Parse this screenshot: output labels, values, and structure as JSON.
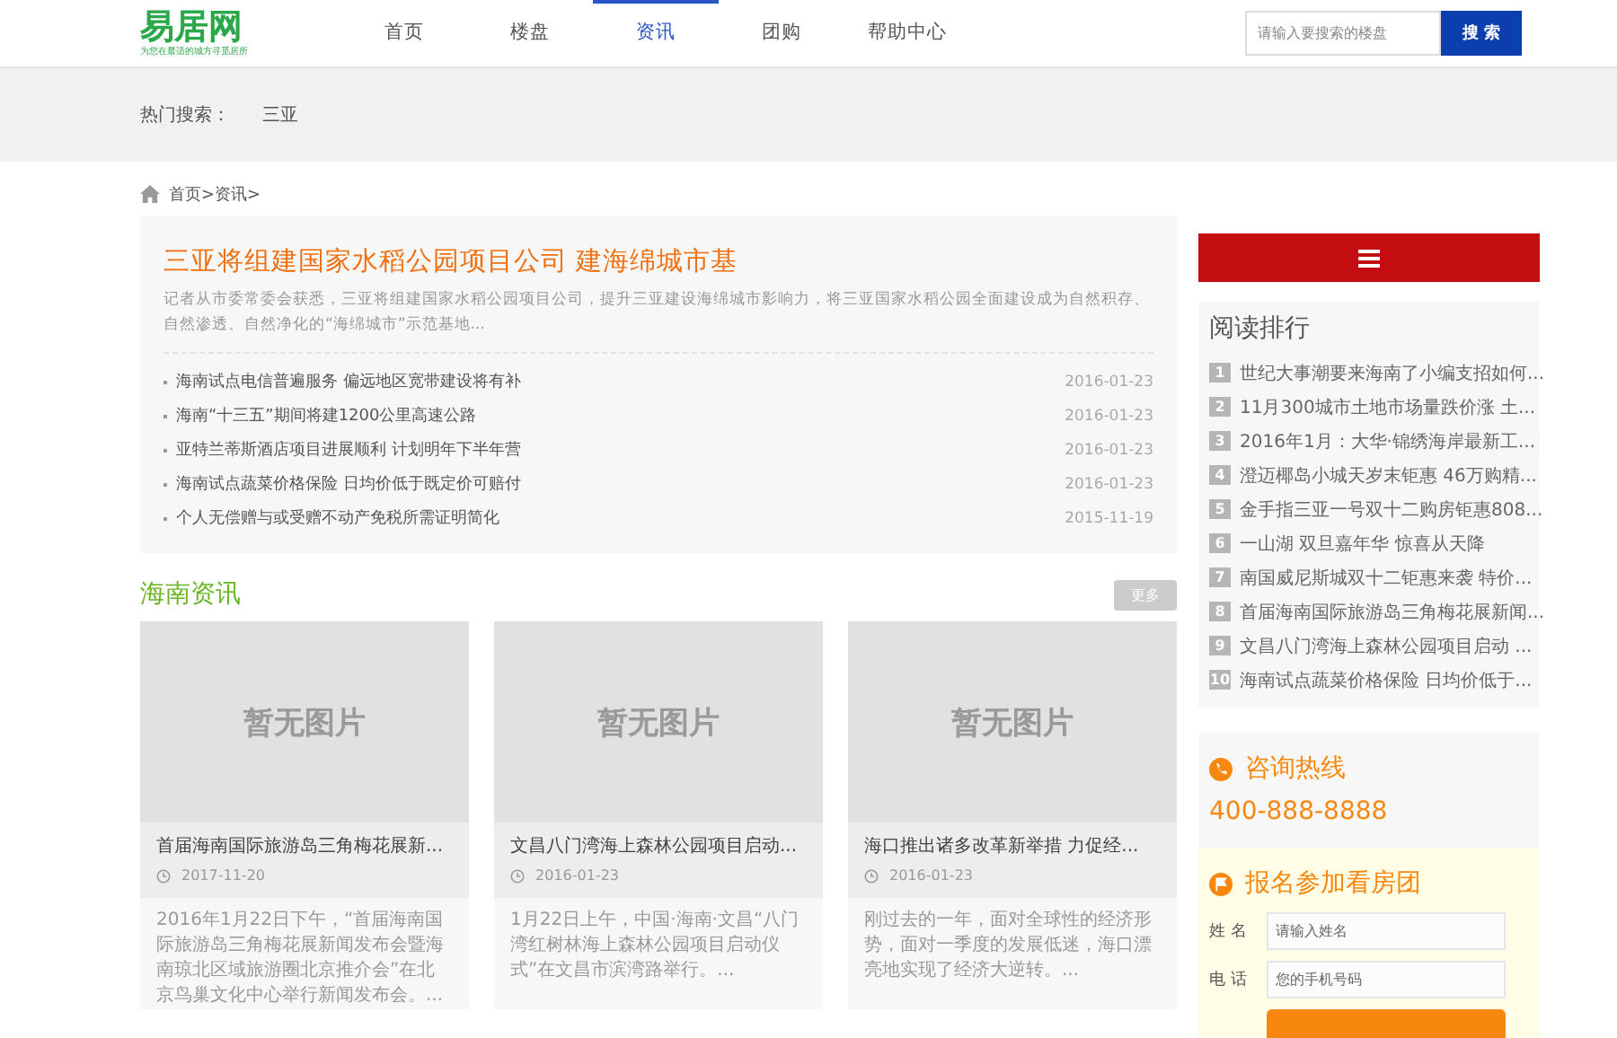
{
  "logo": {
    "name": "易居网",
    "tagline": "为您在最适的城方寻觅居所"
  },
  "nav": [
    {
      "label": "首页",
      "selected": false
    },
    {
      "label": "楼盘",
      "selected": false
    },
    {
      "label": "资讯",
      "selected": true
    },
    {
      "label": "团购",
      "selected": false
    },
    {
      "label": "帮助中心",
      "selected": false
    }
  ],
  "search": {
    "placeholder": "请输入要搜索的楼盘",
    "button": "搜 索"
  },
  "hot_search": {
    "label": "热门搜索：",
    "items": [
      "三亚"
    ]
  },
  "breadcrumb": "首页>资讯>",
  "featured": {
    "title": "三亚将组建国家水稻公园项目公司 建海绵城市基",
    "summary": "记者从市委常委会获悉，三亚将组建国家水稻公园项目公司，提升三亚建设海绵城市影响力，将三亚国家水稻公园全面建设成为自然积存、自然渗透、自然净化的“海绵城市”示范基地...",
    "list": [
      {
        "title": "海南试点电信普遍服务 偏远地区宽带建设将有补",
        "date": "2016-01-23"
      },
      {
        "title": "海南“十三五”期间将建1200公里高速公路",
        "date": "2016-01-23"
      },
      {
        "title": "亚特兰蒂斯酒店项目进展顺利 计划明年下半年营",
        "date": "2016-01-23"
      },
      {
        "title": "海南试点蔬菜价格保险 日均价低于既定价可赔付",
        "date": "2016-01-23"
      },
      {
        "title": "个人无偿赠与或受赠不动产免税所需证明简化",
        "date": "2015-11-19"
      }
    ]
  },
  "section": {
    "title": "海南资讯",
    "more": "更多"
  },
  "cards": [
    {
      "placeholder": "暂无图片",
      "title": "首届海南国际旅游岛三角梅花展新...",
      "date": "2017-11-20",
      "excerpt": "2016年1月22日下午，“首届海南国际旅游岛三角梅花展新闻发布会暨海南琼北区域旅游圈北京推介会”在北京鸟巢文化中心举行新闻发布会。..."
    },
    {
      "placeholder": "暂无图片",
      "title": "文昌八门湾海上森林公园项目启动...",
      "date": "2016-01-23",
      "excerpt": "1月22日上午，中国·海南·文昌“八门湾红树林海上森林公园项目启动仪式”在文昌市滨湾路举行。..."
    },
    {
      "placeholder": "暂无图片",
      "title": "海口推出诸多改革新举措 力促经...",
      "date": "2016-01-23",
      "excerpt": "刚过去的一年，面对全球性的经济形势，面对一季度的发展低迷，海口漂亮地实现了经济大逆转。..."
    }
  ],
  "ranking": {
    "title": "阅读排行",
    "items": [
      {
        "rank": "1",
        "title": "世纪大事潮要来海南了小编支招如何..."
      },
      {
        "rank": "2",
        "title": "11月300城市土地市场量跌价涨 土..."
      },
      {
        "rank": "3",
        "title": "2016年1月：大华·锦绣海岸最新工..."
      },
      {
        "rank": "4",
        "title": "澄迈椰岛小城天岁末钜惠 46万购精..."
      },
      {
        "rank": "5",
        "title": "金手指三亚一号双十二购房钜惠808..."
      },
      {
        "rank": "6",
        "title": "一山湖 双旦嘉年华 惊喜从天降"
      },
      {
        "rank": "7",
        "title": "南国威尼斯城双十二钜惠来袭 特价..."
      },
      {
        "rank": "8",
        "title": "首届海南国际旅游岛三角梅花展新闻..."
      },
      {
        "rank": "9",
        "title": "文昌八门湾海上森林公园项目启动 ..."
      },
      {
        "rank": "10",
        "title": "海南试点蔬菜价格保险 日均价低于..."
      }
    ]
  },
  "hotline": {
    "title": "咨询热线",
    "phone": "400-888-8888"
  },
  "signup": {
    "title": "报名参加看房团",
    "fields": [
      {
        "label": "姓 名",
        "placeholder": "请输入姓名"
      },
      {
        "label": "电 话",
        "placeholder": "您的手机号码"
      }
    ]
  }
}
